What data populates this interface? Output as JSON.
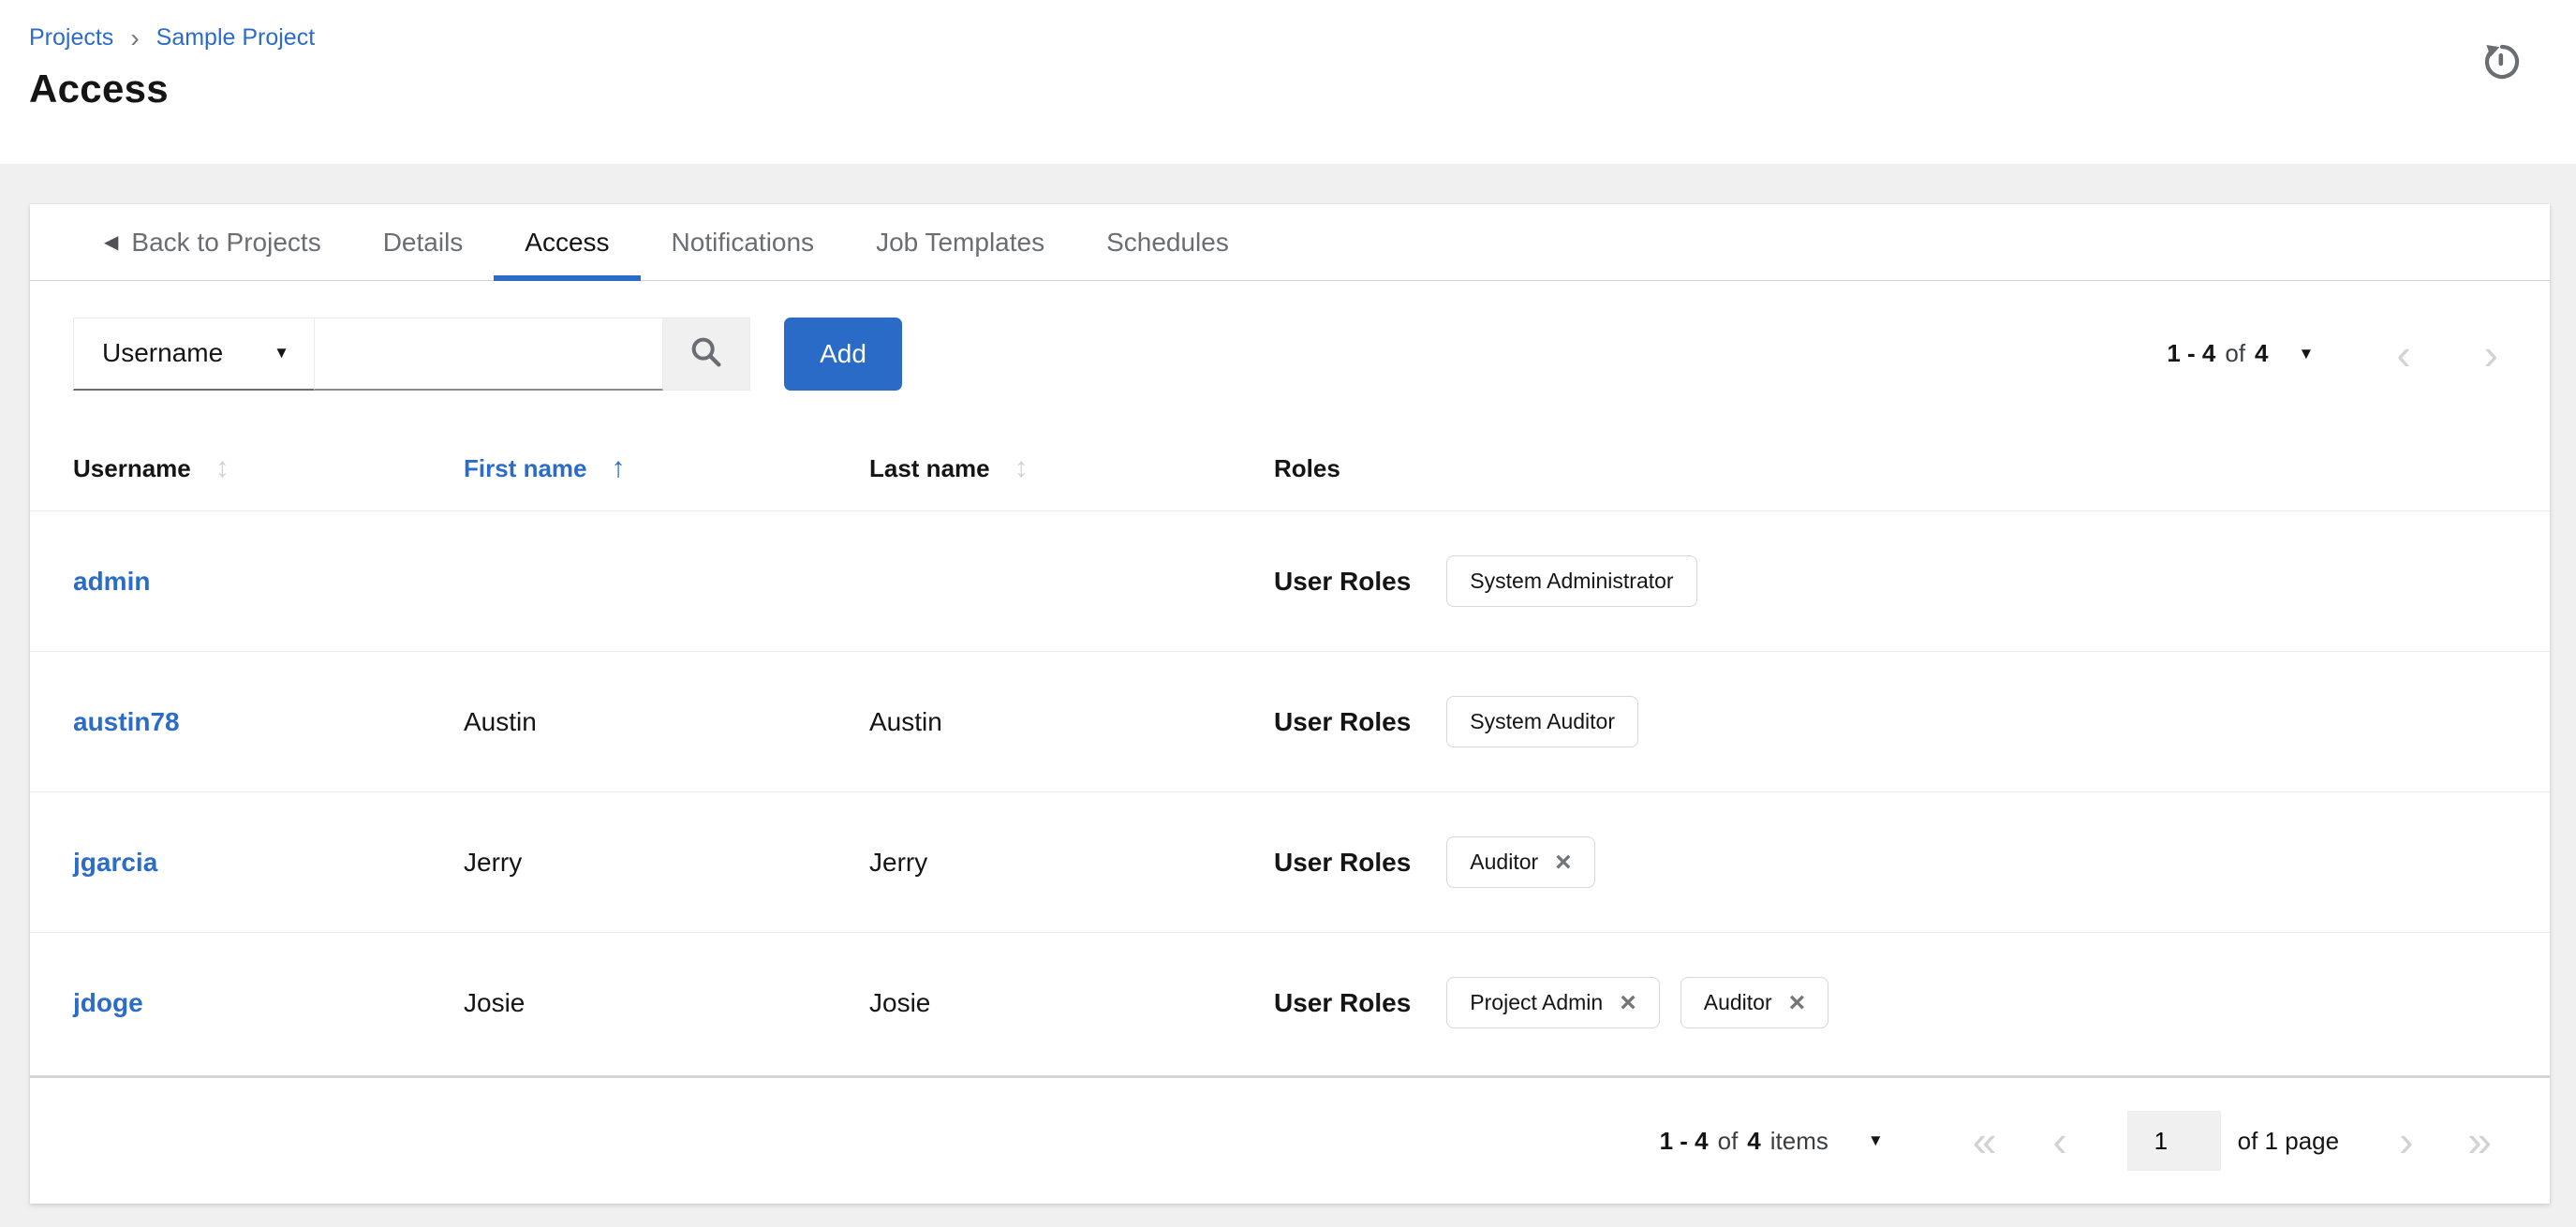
{
  "colors": {
    "accent": "#2a6bc8",
    "link": "#2b6cc9",
    "page_background": "#f0f0f0",
    "tab_inactive": "#6a6e73",
    "text": "#151515",
    "divider": "#d2d2d2",
    "disabled_chevron": "#d2d2d2"
  },
  "icons": {
    "caret_down": "▼",
    "sort_both": "↕",
    "sort_asc": "↑",
    "chevron_left": "‹",
    "chevron_right": "›",
    "chevron_double_left": "«",
    "chevron_double_right": "»",
    "back_triangle": "◀",
    "close": "×",
    "breadcrumb_sep": "›"
  },
  "breadcrumb": {
    "items": [
      {
        "label": "Projects"
      },
      {
        "label": "Sample Project"
      }
    ]
  },
  "page_title": "Access",
  "tabs": [
    {
      "label": "Back to Projects"
    },
    {
      "label": "Details"
    },
    {
      "label": "Access"
    },
    {
      "label": "Notifications"
    },
    {
      "label": "Job Templates"
    },
    {
      "label": "Schedules"
    }
  ],
  "toolbar": {
    "filter_selected": "Username",
    "search_value": "",
    "add_label": "Add"
  },
  "pagination_top": {
    "range": "1 - 4",
    "of": "of",
    "total": "4"
  },
  "table": {
    "columns": [
      {
        "label": "Username"
      },
      {
        "label": "First name"
      },
      {
        "label": "Last name"
      },
      {
        "label": "Roles"
      }
    ],
    "rows": [
      {
        "username": "admin",
        "first": "",
        "last": "",
        "roles_label": "User Roles",
        "chips": [
          {
            "label": "System Administrator",
            "removable": false
          }
        ]
      },
      {
        "username": "austin78",
        "first": "Austin",
        "last": "Austin",
        "roles_label": "User Roles",
        "chips": [
          {
            "label": "System Auditor",
            "removable": false
          }
        ]
      },
      {
        "username": "jgarcia",
        "first": "Jerry",
        "last": "Jerry",
        "roles_label": "User Roles",
        "chips": [
          {
            "label": "Auditor",
            "removable": true
          }
        ]
      },
      {
        "username": "jdoge",
        "first": "Josie",
        "last": "Josie",
        "roles_label": "User Roles",
        "chips": [
          {
            "label": "Project Admin",
            "removable": true
          },
          {
            "label": "Auditor",
            "removable": true
          }
        ]
      }
    ]
  },
  "pagination_bottom": {
    "range": "1 - 4",
    "of": "of",
    "total": "4",
    "items_word": "items",
    "page_value": "1",
    "page_suffix": "of 1 page"
  }
}
